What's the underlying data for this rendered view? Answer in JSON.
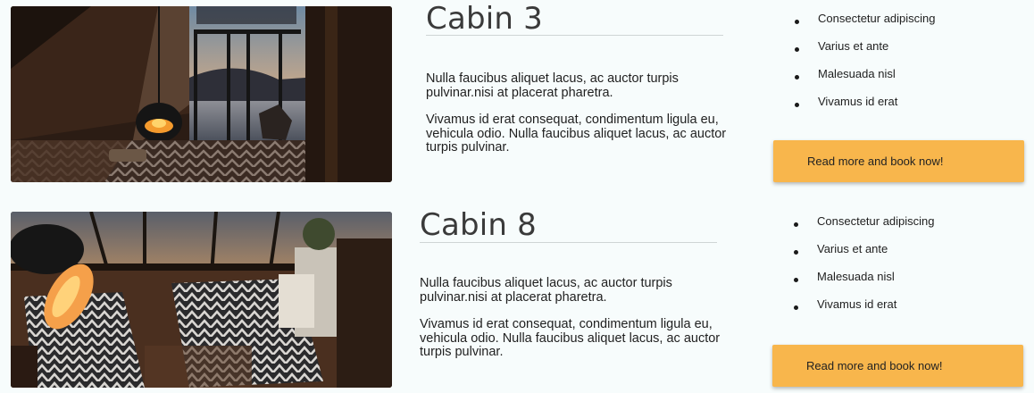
{
  "cabins": [
    {
      "title": "Cabin 3",
      "paragraph1": "Nulla faucibus aliquet lacus, ac auctor turpis pulvinar.nisi at placerat pharetra.",
      "paragraph2": "Vivamus id erat consequat, condimentum ligula eu, vehicula odio. Nulla faucibus aliquet lacus, ac auctor turpis pulvinar.",
      "features": [
        "Consectetur adipiscing",
        "Varius et ante",
        "Malesuada nisl",
        "Vivamus id erat"
      ],
      "button_label": "Read more and book now!"
    },
    {
      "title": "Cabin 8",
      "paragraph1": "Nulla faucibus aliquet lacus, ac auctor turpis pulvinar.nisi at placerat pharetra.",
      "paragraph2": "Vivamus id erat consequat, condimentum ligula eu, vehicula odio. Nulla faucibus aliquet lacus, ac auctor turpis pulvinar.",
      "features": [
        "Consectetur adipiscing",
        "Varius et ante",
        "Malesuada nisl",
        "Vivamus id erat"
      ],
      "button_label": "Read more and book now!"
    }
  ],
  "colors": {
    "background": "#f7fcfc",
    "button": "#f8b64c"
  }
}
